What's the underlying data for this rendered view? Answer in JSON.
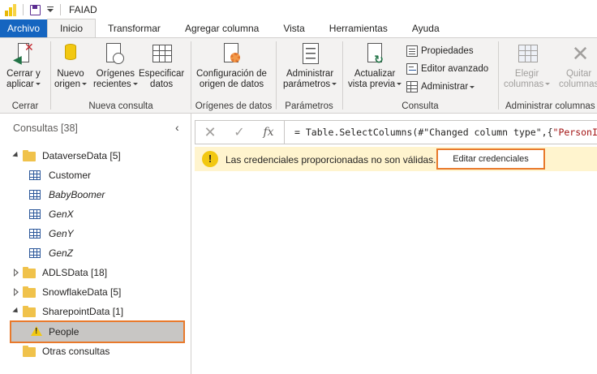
{
  "window": {
    "title": "FAIAD"
  },
  "tabs": [
    {
      "label": "Archivo"
    },
    {
      "label": "Inicio"
    },
    {
      "label": "Transformar"
    },
    {
      "label": "Agregar columna"
    },
    {
      "label": "Vista"
    },
    {
      "label": "Herramientas"
    },
    {
      "label": "Ayuda"
    }
  ],
  "ribbon": {
    "cerrar": {
      "btn_line1": "Cerrar y",
      "btn_line2": "aplicar",
      "group": "Cerrar"
    },
    "nueva_consulta": {
      "nuevo_l1": "Nuevo",
      "nuevo_l2": "origen",
      "recientes_l1": "Orígenes",
      "recientes_l2": "recientes",
      "especificar_l1": "Especificar",
      "especificar_l2": "datos",
      "group": "Nueva consulta"
    },
    "origenes": {
      "btn_l1": "Configuración de",
      "btn_l2": "origen de datos",
      "group": "Orígenes de datos"
    },
    "parametros": {
      "btn_l1": "Administrar",
      "btn_l2": "parámetros",
      "group": "Parámetros"
    },
    "consulta": {
      "actualizar_l1": "Actualizar",
      "actualizar_l2": "vista previa",
      "propiedades": "Propiedades",
      "editor": "Editor avanzado",
      "administrar": "Administrar",
      "group": "Consulta"
    },
    "columnas": {
      "elegir_l1": "Elegir",
      "elegir_l2": "columnas",
      "quitar_l1": "Quitar",
      "quitar_l2": "columnas",
      "group": "Administrar columnas"
    }
  },
  "queries": {
    "header": "Consultas [38]",
    "groups": [
      {
        "label": "DataverseData [5]"
      },
      {
        "label": "ADLSData [18]"
      },
      {
        "label": "SnowflakeData [5]"
      },
      {
        "label": "SharepointData [1]"
      },
      {
        "label": "Otras consultas"
      }
    ],
    "dataverse_items": [
      "Customer",
      "BabyBoomer",
      "GenX",
      "GenY",
      "GenZ"
    ],
    "sharepoint_items": [
      "People"
    ]
  },
  "formula_bar": {
    "prefix": "= Table.SelectColumns(#",
    "str1": "\"Changed column type\"",
    "mid": ",{",
    "str2": "\"PersonID\"",
    "suffix": ","
  },
  "warning": {
    "message": "Las credenciales proporcionadas no son válidas.",
    "button": "Editar credenciales"
  },
  "colors": {
    "accent": "#1565c0",
    "highlight": "#e8792b",
    "warning_bg": "#fff4ce"
  },
  "icons": [
    "power-bi-logo",
    "save-icon",
    "close-apply-icon",
    "new-source-icon",
    "recent-sources-icon",
    "enter-data-icon",
    "data-source-settings-icon",
    "manage-parameters-icon",
    "refresh-preview-icon",
    "properties-icon",
    "advanced-editor-icon",
    "manage-icon",
    "choose-columns-icon",
    "remove-columns-icon",
    "folder-icon",
    "table-icon",
    "warning-icon"
  ]
}
